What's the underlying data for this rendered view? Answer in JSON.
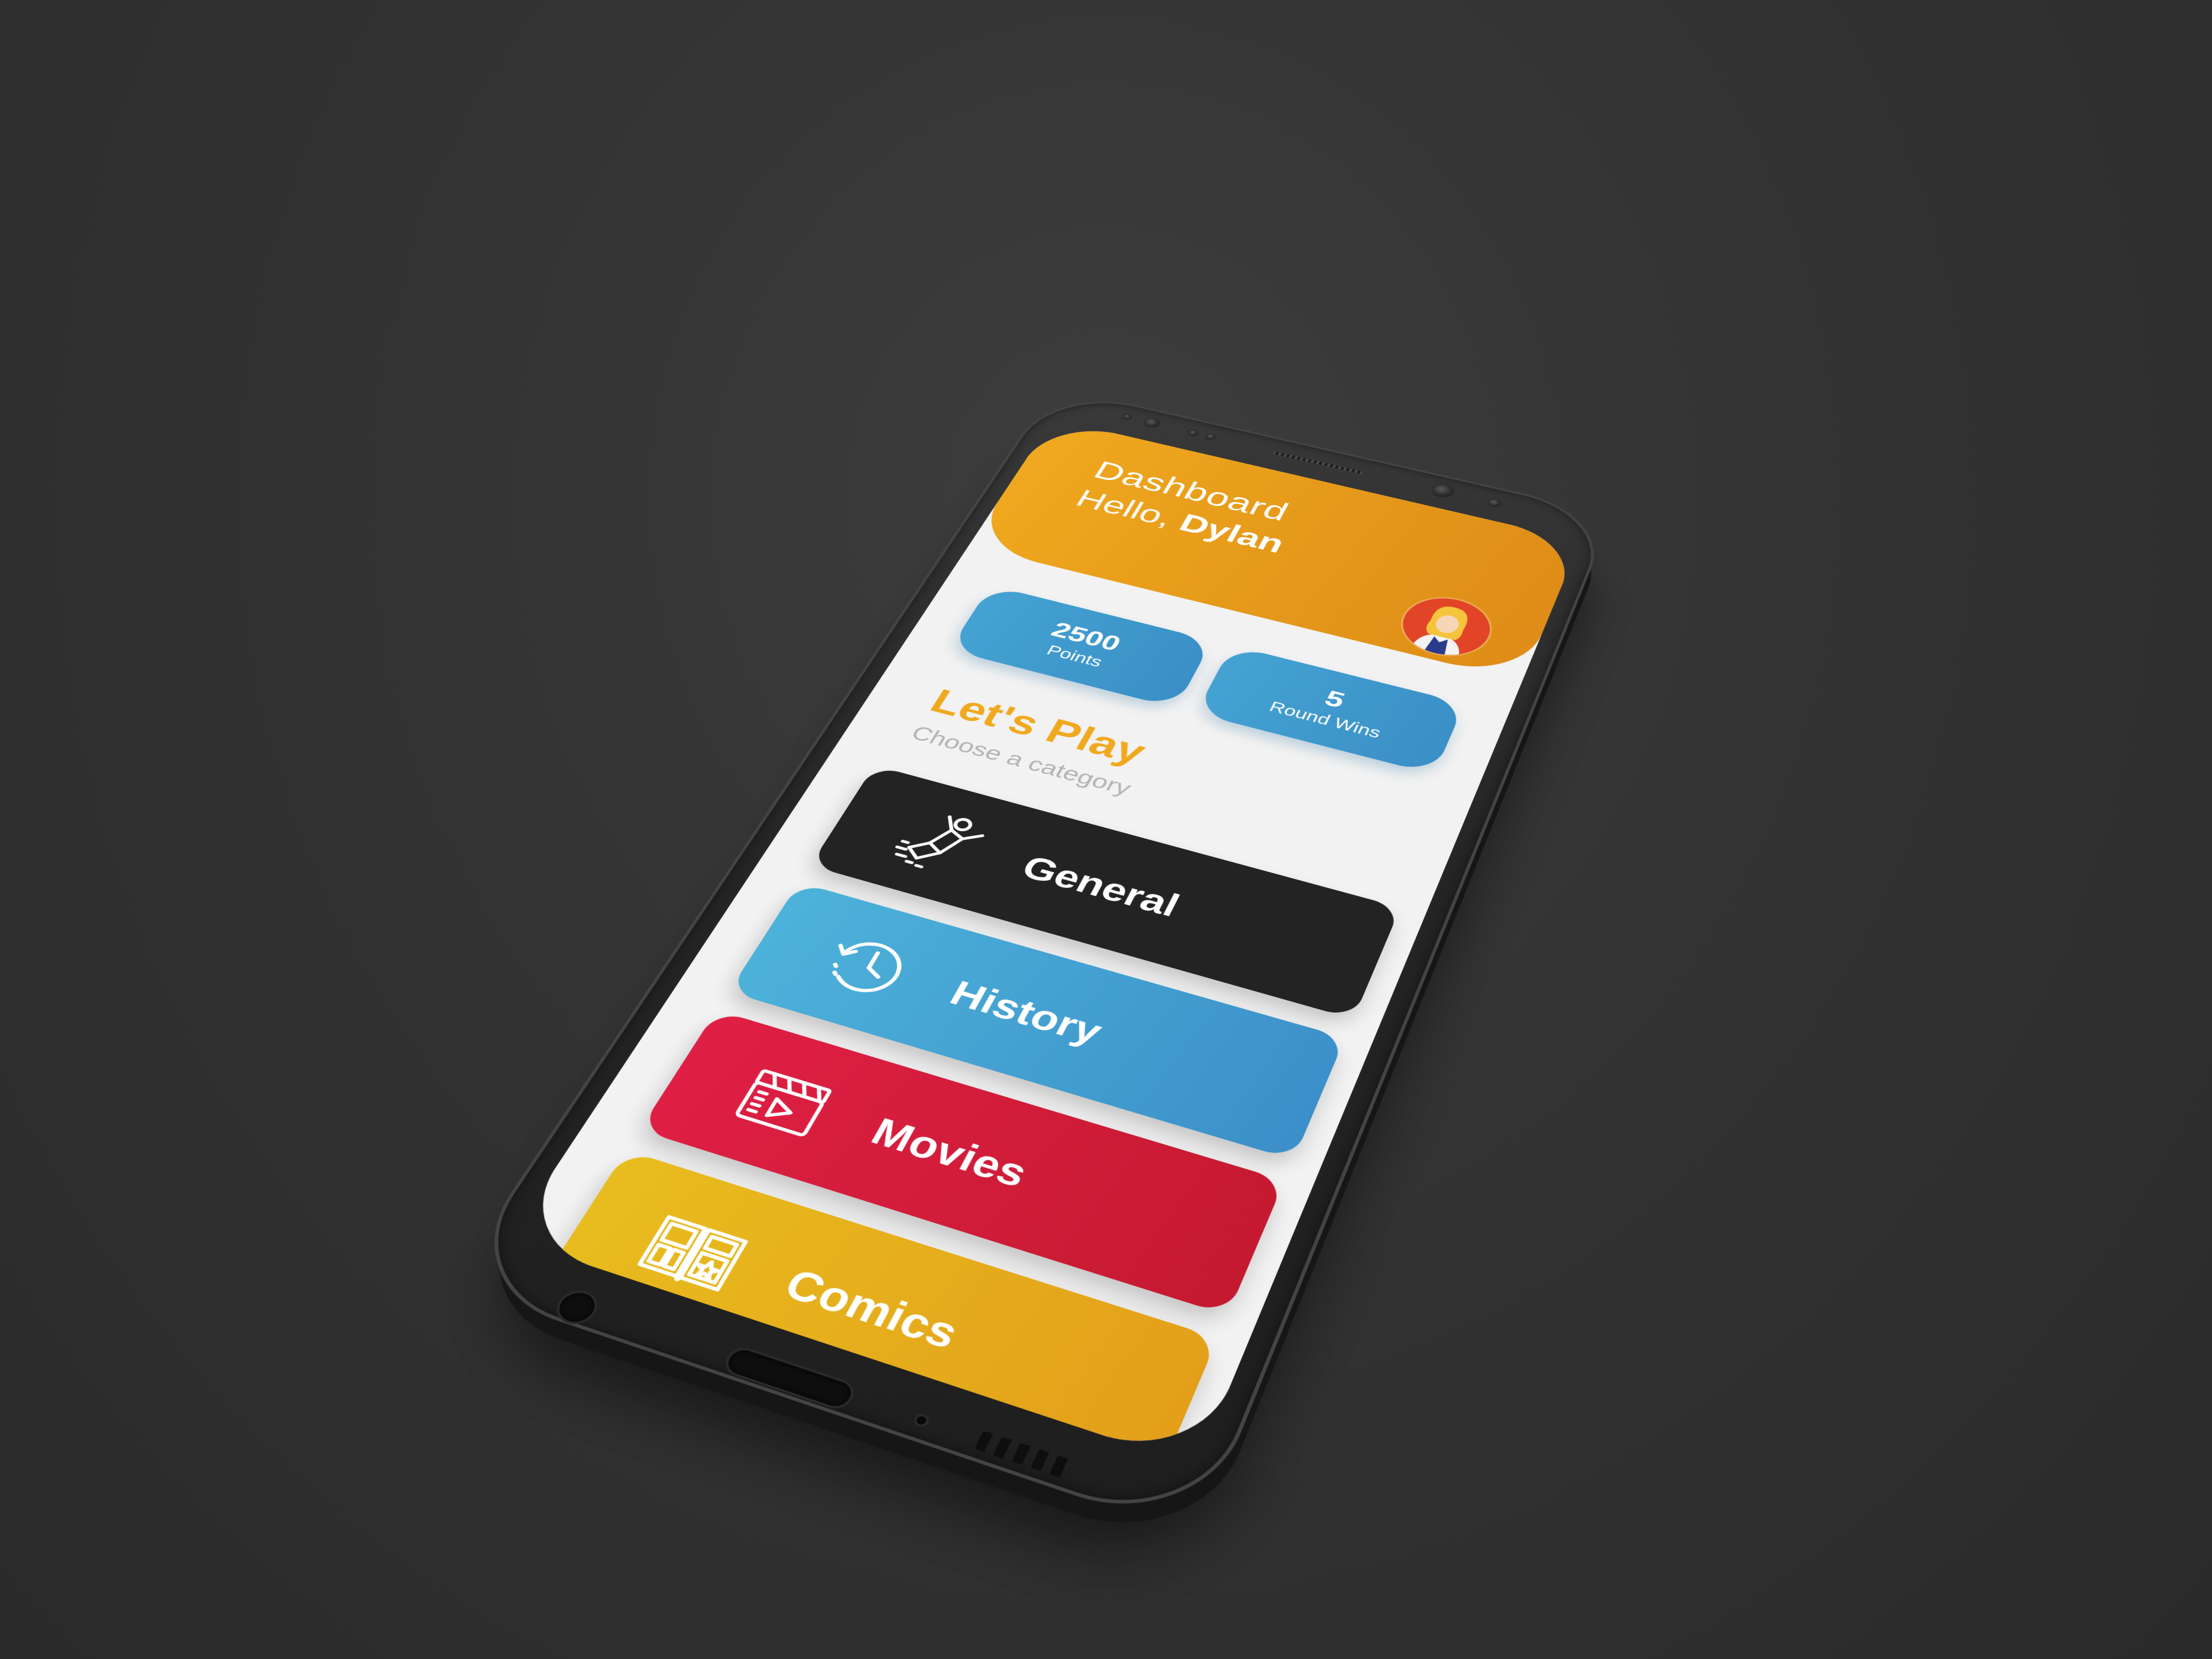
{
  "header": {
    "title": "Dashboard",
    "greeting_prefix": "Hello, ",
    "user_name": "Dylan"
  },
  "stats": {
    "points_value": "2500",
    "points_label": "Points",
    "wins_value": "5",
    "wins_label": "Round Wins"
  },
  "section": {
    "title": "Let's Play",
    "subtitle": "Choose a category"
  },
  "categories": [
    {
      "label": "General",
      "icon": "superhero-flying-icon",
      "color": "#232323"
    },
    {
      "label": "History",
      "icon": "history-clock-icon",
      "color": "#4aa9d6"
    },
    {
      "label": "Movies",
      "icon": "clapperboard-play-icon",
      "color": "#d81f3c"
    },
    {
      "label": "Comics",
      "icon": "comic-book-icon",
      "color": "#e6b21c"
    }
  ],
  "colors": {
    "background": "#333333",
    "accent_orange": "#f0a91f",
    "stat_blue": "#3a8fc6",
    "screen_bg": "#f2f2f2"
  }
}
